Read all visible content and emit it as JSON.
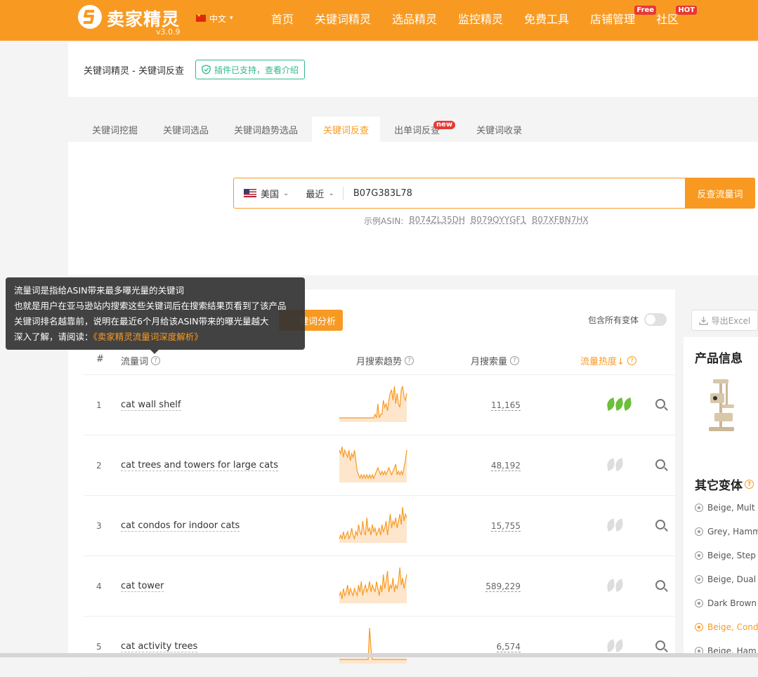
{
  "header": {
    "logo_text": "卖家精灵",
    "version": "v3.0.9",
    "language": "中文",
    "nav": [
      {
        "label": "首页",
        "badge": ""
      },
      {
        "label": "关键词精灵",
        "badge": ""
      },
      {
        "label": "选品精灵",
        "badge": ""
      },
      {
        "label": "监控精灵",
        "badge": ""
      },
      {
        "label": "免费工具",
        "badge": ""
      },
      {
        "label": "店铺管理",
        "badge": "Free"
      },
      {
        "label": "社区",
        "badge": "HOT"
      }
    ]
  },
  "breadcrumb": {
    "text": "关键词精灵 - 关键词反查",
    "plugin_badge": "插件已支持，查看介绍"
  },
  "tabs": [
    {
      "label": "关键词挖掘",
      "active": false,
      "badge": ""
    },
    {
      "label": "关键词选品",
      "active": false,
      "badge": ""
    },
    {
      "label": "关键词趋势选品",
      "active": false,
      "badge": ""
    },
    {
      "label": "关键词反查",
      "active": true,
      "badge": ""
    },
    {
      "label": "出单词反查",
      "active": false,
      "badge": "new"
    },
    {
      "label": "关键词收录",
      "active": false,
      "badge": ""
    }
  ],
  "search": {
    "marketplace": "美国",
    "period": "最近",
    "asin_value": "B07G383L78",
    "button": "反查流量词",
    "examples_label": "示例ASIN:",
    "examples": [
      "B074ZL35DH",
      "B079QYYGF1",
      "B07XFBN7HX"
    ]
  },
  "tooltip": {
    "lines": [
      "流量词是指给ASIN带来最多曝光量的关键词",
      "也就是用户在亚马逊站内搜索这些关键词后在搜索结果页看到了该产品",
      "关键词排名越靠前，说明在最近6个月给该ASIN带来的曝光量越大"
    ],
    "read_prefix": "深入了解，请阅读：",
    "read_link": "《卖家精灵流量词深度解析》"
  },
  "toolbar": {
    "analyze_button": "键词分析",
    "variants_toggle_label": "包含所有变体",
    "export_button": "导出Excel"
  },
  "table": {
    "headers": {
      "index": "#",
      "keyword": "流量词",
      "trend": "月搜索趋势",
      "volume": "月搜索量",
      "heat": "流量热度↓"
    },
    "rows": [
      {
        "index": "1",
        "keyword": "cat wall shelf",
        "volume": "11,165",
        "heat": 3,
        "trend": [
          1,
          1,
          1,
          1,
          1,
          1,
          1,
          1,
          1,
          1,
          1,
          1,
          1,
          1,
          1,
          1,
          1,
          1,
          1,
          1,
          1,
          1,
          1,
          1,
          1,
          1,
          2,
          1,
          5,
          1,
          2,
          2,
          6,
          4,
          5,
          3,
          6,
          8,
          9,
          6,
          10,
          5,
          8,
          5,
          4,
          9,
          10,
          7,
          6,
          8
        ]
      },
      {
        "index": "2",
        "keyword": "cat trees and towers for large cats",
        "volume": "48,192",
        "heat": 0,
        "trend": [
          9,
          8,
          10,
          7,
          9,
          8,
          7,
          9,
          6,
          8,
          7,
          9,
          6,
          3,
          2,
          1,
          2,
          1,
          2,
          1,
          2,
          1,
          2,
          1,
          2,
          1,
          2,
          3,
          4,
          3,
          2,
          3,
          2,
          3,
          2,
          3,
          4,
          3,
          2,
          3,
          4,
          5,
          2,
          3,
          2,
          3,
          2,
          4,
          6,
          9
        ]
      },
      {
        "index": "3",
        "keyword": "cat condos for indoor cats",
        "volume": "15,755",
        "heat": 0,
        "trend": [
          1,
          2,
          1,
          3,
          1,
          2,
          3,
          1,
          2,
          4,
          2,
          1,
          3,
          2,
          5,
          3,
          2,
          6,
          3,
          2,
          7,
          3,
          4,
          2,
          5,
          3,
          4,
          2,
          3,
          4,
          2,
          5,
          3,
          4,
          6,
          2,
          5,
          8,
          4,
          6,
          5,
          7,
          4,
          6,
          8,
          5,
          10,
          6,
          8,
          7
        ]
      },
      {
        "index": "4",
        "keyword": "cat tower",
        "volume": "589,229",
        "heat": 0,
        "trend": [
          2,
          3,
          1,
          4,
          2,
          3,
          5,
          2,
          4,
          3,
          2,
          4,
          3,
          2,
          5,
          3,
          6,
          2,
          4,
          5,
          3,
          4,
          6,
          3,
          5,
          4,
          3,
          6,
          4,
          2,
          5,
          3,
          8,
          4,
          6,
          9,
          3,
          5,
          4,
          7,
          3,
          5,
          4,
          6,
          10,
          5,
          7,
          4,
          6,
          8
        ]
      },
      {
        "index": "5",
        "keyword": "cat activity trees",
        "volume": "6,574",
        "heat": 0,
        "trend": [
          1,
          1,
          1,
          1,
          1,
          1,
          1,
          1,
          1,
          1,
          1,
          1,
          1,
          1,
          1,
          1,
          1,
          1,
          1,
          1,
          1,
          1,
          10,
          4,
          1,
          1,
          1,
          1,
          1,
          1,
          1,
          1,
          1,
          1,
          1,
          1,
          1,
          1,
          1,
          1,
          1,
          1,
          1,
          1,
          1,
          1,
          1,
          1,
          1,
          1
        ]
      }
    ]
  },
  "product_panel": {
    "title": "产品信息",
    "variants_title": "其它变体",
    "variants": [
      {
        "label": "Beige, Mult",
        "selected": false
      },
      {
        "label": "Grey, Hamm",
        "selected": false
      },
      {
        "label": "Beige, Step",
        "selected": false
      },
      {
        "label": "Beige, Dual",
        "selected": false
      },
      {
        "label": "Dark Brown",
        "selected": false
      },
      {
        "label": "Beige, Cond",
        "selected": true
      },
      {
        "label": "Beige, Ham",
        "selected": false
      }
    ]
  },
  "colors": {
    "accent": "#f89a22",
    "green": "#2fb98b",
    "leaf_on": "#6cbf3a",
    "leaf_off": "#dddddd"
  }
}
